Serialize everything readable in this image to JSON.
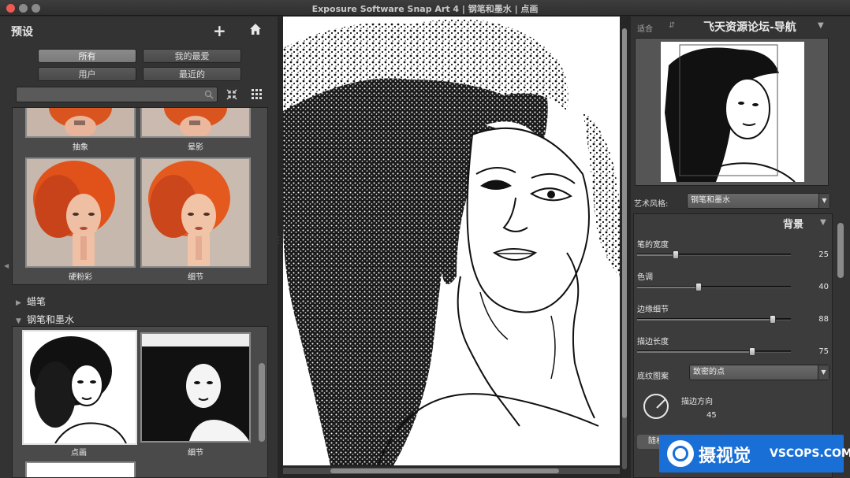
{
  "window": {
    "title": "Exposure Software Snap Art 4 | 钢笔和墨水 | 点画"
  },
  "presets_panel": {
    "title": "预设",
    "filters": [
      {
        "label": "所有"
      },
      {
        "label": "我的最爱"
      },
      {
        "label": "用户"
      },
      {
        "label": "最近的"
      }
    ],
    "search_placeholder": "",
    "group1": [
      {
        "label": "抽象"
      },
      {
        "label": "晕影"
      },
      {
        "label": "硬粉彩"
      },
      {
        "label": "细节"
      }
    ],
    "sections": [
      {
        "label": "蜡笔",
        "expanded": false
      },
      {
        "label": "钢笔和墨水",
        "expanded": true
      }
    ],
    "group2": [
      {
        "label": "点画",
        "selected": true
      },
      {
        "label": "细节"
      }
    ]
  },
  "navigator": {
    "fit_label": "适合",
    "title": "飞天资源论坛-导航"
  },
  "art_style": {
    "label": "艺术风格:",
    "value": "钢笔和墨水"
  },
  "settings": {
    "section_title": "背景",
    "sliders": [
      {
        "label": "笔的宽度",
        "value": "25",
        "fraction": 0.25
      },
      {
        "label": "色调",
        "value": "40",
        "fraction": 0.4
      },
      {
        "label": "边缘细节",
        "value": "88",
        "fraction": 0.88
      },
      {
        "label": "描边长度",
        "value": "75",
        "fraction": 0.75
      }
    ],
    "texture_label": "底纹图案",
    "texture_value": "致密的点",
    "direction_label": "描边方向",
    "direction_value": "45",
    "random_button": "随机"
  },
  "watermark": {
    "text_cn": "摄视觉",
    "text_en": "VSCOPS.COM"
  },
  "colors": {
    "accent_blue": "#1a6fd6",
    "close_red": "#ee5a52"
  }
}
